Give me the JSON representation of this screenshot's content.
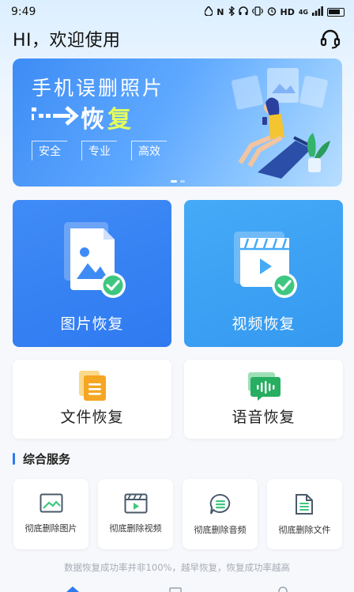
{
  "status_bar": {
    "time": "9:49",
    "hd": "HD",
    "network": "4G",
    "icons": [
      "drop-icon",
      "nfc-icon",
      "bluetooth-icon",
      "headphone-icon",
      "vibrate-icon",
      "alarm-icon",
      "signal-icon",
      "battery-icon"
    ]
  },
  "header": {
    "greeting": "HI，欢迎使用",
    "support_icon": "headset-icon"
  },
  "banner": {
    "title": "手机误删照片",
    "subtitle_main": "恢",
    "subtitle_hl": "复",
    "tags": [
      "安全",
      "专业",
      "高效"
    ],
    "dots": 2,
    "active_dot": 0
  },
  "features": {
    "photo": {
      "label": "图片恢复",
      "icon": "image-check-icon",
      "color": "#2f7af0"
    },
    "video": {
      "label": "视频恢复",
      "icon": "video-check-icon",
      "color": "#3599f0"
    },
    "file": {
      "label": "文件恢复",
      "icon": "document-icon",
      "color": "#f5a623"
    },
    "audio": {
      "label": "语音恢复",
      "icon": "voice-message-icon",
      "color": "#27ae60"
    }
  },
  "services": {
    "title": "综合服务",
    "items": [
      {
        "label": "彻底删除图片",
        "icon": "image-icon"
      },
      {
        "label": "彻底删除视频",
        "icon": "video-icon"
      },
      {
        "label": "彻底删除音频",
        "icon": "audio-icon"
      },
      {
        "label": "彻底删除文件",
        "icon": "file-icon"
      }
    ]
  },
  "footer": {
    "note": "数据恢复成功率并非100%，越早恢复，恢复成功率越高"
  }
}
